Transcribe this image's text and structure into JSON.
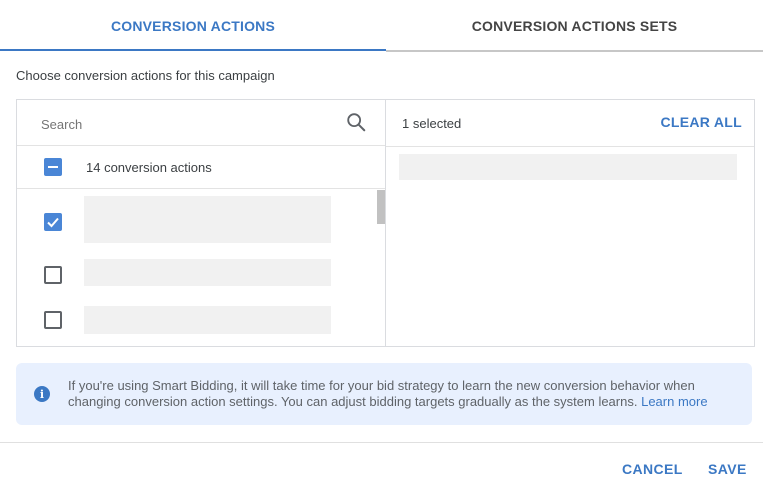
{
  "tabs": [
    {
      "label": "CONVERSION ACTIONS",
      "active": true
    },
    {
      "label": "CONVERSION ACTIONS SETS",
      "active": false
    }
  ],
  "subtitle": "Choose conversion actions for this campaign",
  "search": {
    "placeholder": "Search",
    "value": "",
    "icon": "search-icon"
  },
  "select_all": {
    "label": "14 conversion actions",
    "state": "indeterminate"
  },
  "list_items": [
    {
      "checked": true,
      "label": ""
    },
    {
      "checked": false,
      "label": ""
    },
    {
      "checked": false,
      "label": ""
    }
  ],
  "selected_panel": {
    "count_label": "1 selected",
    "clear_label": "CLEAR ALL"
  },
  "info": {
    "icon": "info-icon",
    "text": "If you're using Smart Bidding, it will take time for your bid strategy to learn the new conversion behavior when changing conversion action settings. You can adjust bidding targets gradually as the system learns.",
    "link": "Learn more"
  },
  "footer": {
    "cancel_label": "CANCEL",
    "save_label": "SAVE"
  },
  "colors": {
    "accent": "#3b78c4",
    "checkbox": "#4a86d6",
    "banner": "#e8f0fe"
  }
}
